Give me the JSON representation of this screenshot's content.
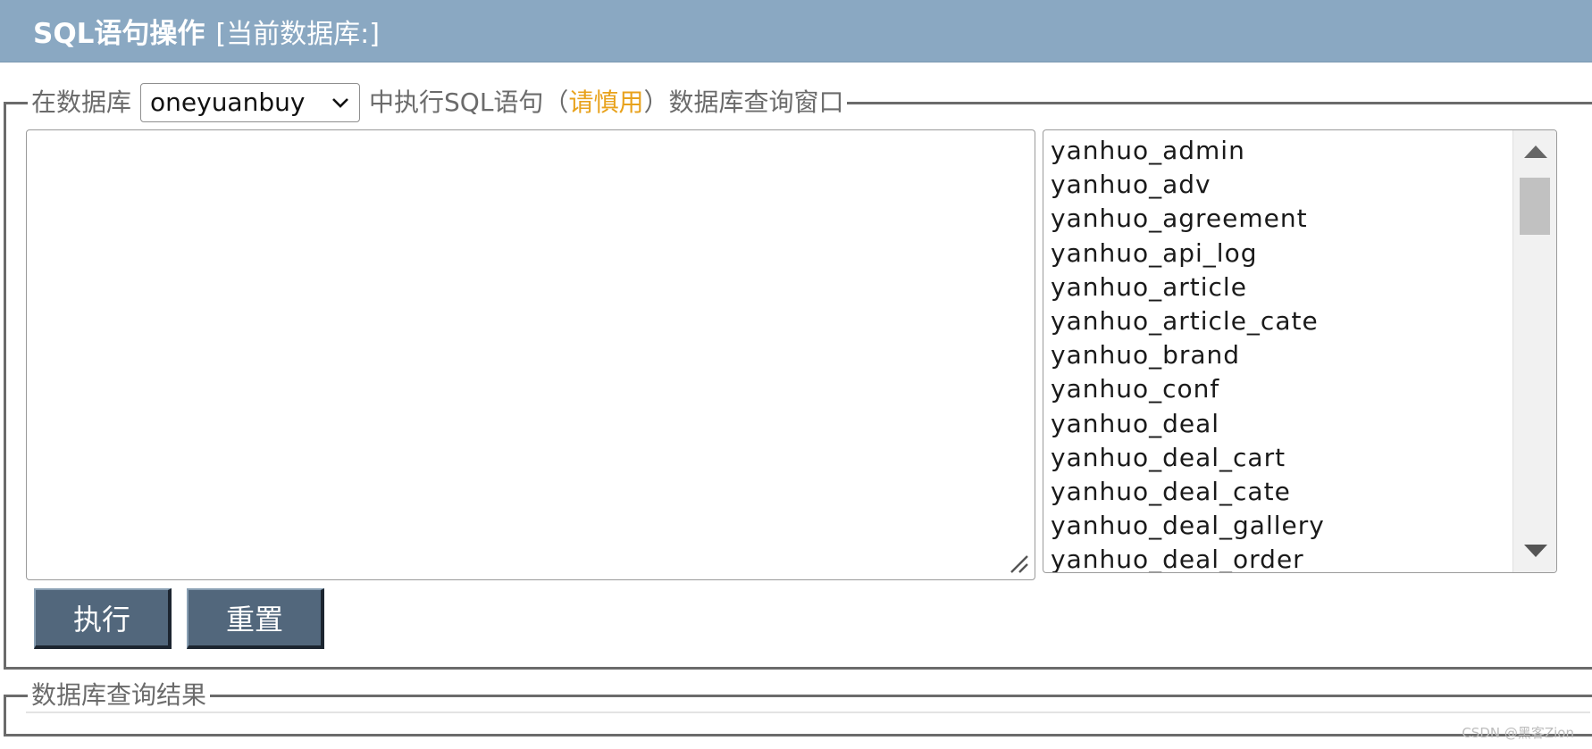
{
  "header": {
    "title": "SQL语句操作",
    "subtitle": "[当前数据库:]"
  },
  "query_panel": {
    "legend_prefix": "在数据库",
    "selected_database": "oneyuanbuy",
    "legend_mid": "中执行SQL语句（",
    "caution": "请慎用",
    "legend_suffix": "）数据库查询窗口",
    "sql_text": "",
    "tables": [
      "yanhuo_admin",
      "yanhuo_adv",
      "yanhuo_agreement",
      "yanhuo_api_log",
      "yanhuo_article",
      "yanhuo_article_cate",
      "yanhuo_brand",
      "yanhuo_conf",
      "yanhuo_deal",
      "yanhuo_deal_cart",
      "yanhuo_deal_cate",
      "yanhuo_deal_gallery",
      "yanhuo_deal_order"
    ],
    "execute_label": "执行",
    "reset_label": "重置"
  },
  "result_panel": {
    "legend": "数据库查询结果"
  },
  "watermark": "CSDN @黑客Zion",
  "colors": {
    "title_bar": "#8aa8c2",
    "button": "#52677c",
    "caution": "#e8a21c"
  }
}
